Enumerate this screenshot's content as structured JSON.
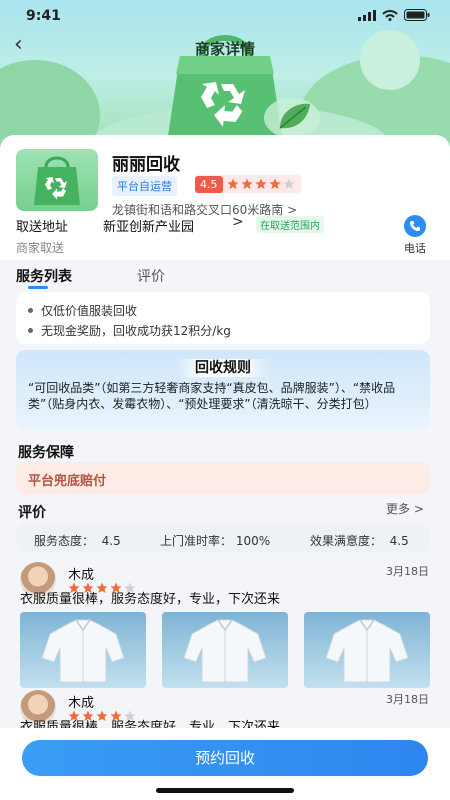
{
  "status_bar": {
    "time": "9:41"
  },
  "header": {
    "title": "商家详情"
  },
  "shop": {
    "name": "丽丽回收",
    "badge": "平台自运营",
    "rating": "4.5",
    "stars_filled": 4,
    "stars_total": 5,
    "address": "龙镇街和语和路交叉口60米路南 >",
    "pickup_label": "取送地址",
    "pickup_value": "新亚创新产业园",
    "pickup_arrow": ">",
    "range_tag": "在取送范围内",
    "merchant_pickup": "商家取送",
    "phone_label": "电话"
  },
  "tabs": [
    {
      "label": "服务列表",
      "active": true
    },
    {
      "label": "评价",
      "active": false
    }
  ],
  "service_items": [
    "仅低价值服装回收",
    "无现金奖励，回收成功获12积分/kg"
  ],
  "rules": {
    "title": "回收规则",
    "text": "“可回收品类”（如第三方轻奢商家支持“真皮包、品牌服装”）、“禁收品类”（贴身内衣、发霉衣物）、“预处理要求”（清洗晾干、分类打包）"
  },
  "guarantee": {
    "title": "服务保障",
    "text": "平台兜底赔付"
  },
  "reviews_section": {
    "title": "评价",
    "more": "更多 >",
    "scores": [
      {
        "label": "服务态度：",
        "value": "4.5"
      },
      {
        "label": "上门准时率：",
        "value": "100%"
      },
      {
        "label": "效果满意度：",
        "value": "4.5"
      }
    ]
  },
  "reviews": [
    {
      "name": "木成",
      "stars_filled": 4,
      "stars_total": 5,
      "date": "3月18日",
      "text": "衣服质量很棒，服务态度好，专业，下次还来",
      "photo_count": 3
    },
    {
      "name": "木成",
      "stars_filled": 4,
      "stars_total": 5,
      "date": "3月18日",
      "text": "衣服质量很棒，服务态度好，专业，下次还来"
    }
  ],
  "cta": {
    "label": "预约回收"
  },
  "colors": {
    "accent": "#2d8cf0",
    "rating_red": "#f05a4e",
    "star_orange": "#f06a3a",
    "star_gray": "#d0d0d0",
    "guarantee_text": "#b3543e",
    "range_green": "#2aa35a"
  },
  "icons": [
    "back-arrow-icon",
    "recycle-bag-icon",
    "phone-icon",
    "star-icon",
    "signal-icon",
    "wifi-icon",
    "battery-icon"
  ]
}
